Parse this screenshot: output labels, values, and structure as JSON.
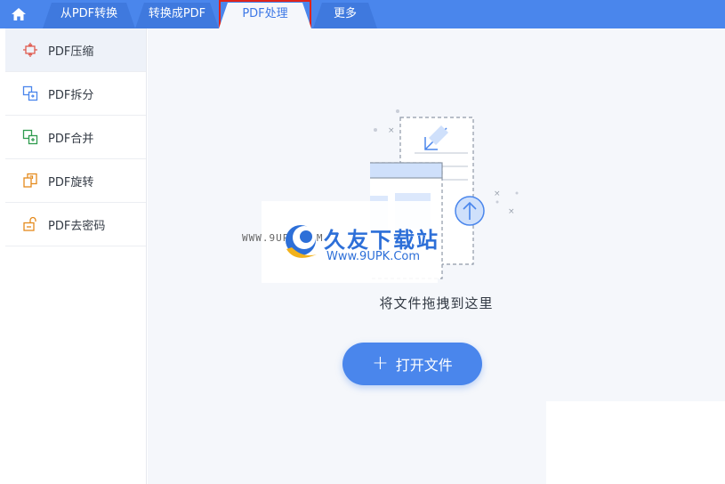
{
  "tabs": [
    {
      "label": "从PDF转换"
    },
    {
      "label": "转换成PDF"
    },
    {
      "label": "PDF处理"
    },
    {
      "label": "更多"
    }
  ],
  "sidebar": {
    "items": [
      {
        "label": "PDF压缩",
        "icon": "compress-icon"
      },
      {
        "label": "PDF拆分",
        "icon": "split-icon"
      },
      {
        "label": "PDF合并",
        "icon": "merge-icon"
      },
      {
        "label": "PDF旋转",
        "icon": "rotate-icon"
      },
      {
        "label": "PDF去密码",
        "icon": "unlock-icon"
      }
    ]
  },
  "main": {
    "drop_text": "将文件拖拽到这里",
    "open_button": "打开文件"
  },
  "watermark": {
    "small": "WWW.9UPK.COM",
    "title": "久友下载站",
    "url": "Www.9UPK.Com"
  },
  "colors": {
    "accent": "#4a86ec",
    "highlight": "#e0241b",
    "icon_red": "#e05a4f",
    "icon_blue": "#4a86ec",
    "icon_green": "#2e9b4e",
    "icon_orange": "#e48a1c"
  }
}
